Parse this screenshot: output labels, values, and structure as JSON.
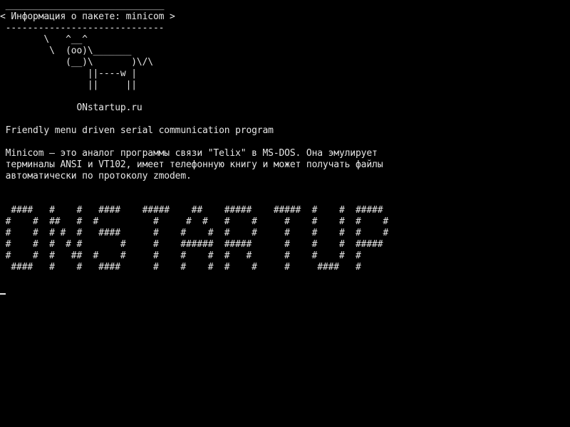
{
  "screen": {
    "lines": [
      " _____________________________",
      "< Информация о пакете: minicom >",
      " -----------------------------",
      "        \\   ^__^",
      "         \\  (oo)\\_______",
      "            (__)\\       )\\/\\",
      "                ||----w |",
      "                ||     ||",
      "",
      "              ONstartup.ru",
      "",
      " Friendly menu driven serial communication program",
      "",
      " Minicom — это аналог программы связи \"Telix\" в MS-DOS. Она эмулирует",
      " терминалы ANSI и VT102, имеет телефонную книгу и может получать файлы",
      " автоматически по протоколу zmodem.",
      "",
      "",
      "  ####   #    #   ####    #####    ##    #####    #####  #    #  #####",
      " #    #  ##   #  #          #     #  #   #    #     #    #    #  #    #",
      " #    #  # #  #   ####      #    #    #  #    #     #    #    #  #    #",
      " #    #  #  # #       #     #    ######  #####      #    #    #  #####",
      " #    #  #   ##  #    #     #    #    #  #   #      #    #    #  #",
      "  ####   #    #   ####      #    #    #  #    #     #     ####   #"
    ],
    "cursor": "_"
  },
  "colors": {
    "background": "#000000",
    "foreground": "#e6e6e6"
  }
}
